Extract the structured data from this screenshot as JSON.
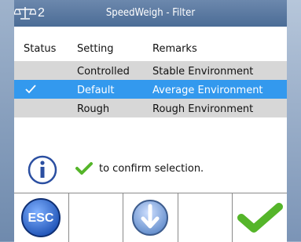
{
  "header": {
    "scale_number": "2",
    "title": "SpeedWeigh - Filter"
  },
  "table": {
    "headers": {
      "status": "Status",
      "setting": "Setting",
      "remarks": "Remarks"
    },
    "rows": [
      {
        "setting": "Controlled",
        "remarks": "Stable Environment",
        "selected": false
      },
      {
        "setting": "Default",
        "remarks": "Average Environment",
        "selected": true
      },
      {
        "setting": "Rough",
        "remarks": "Rough Environment",
        "selected": false
      }
    ]
  },
  "hint": {
    "text": "to confirm selection."
  },
  "softkeys": {
    "esc_label": "ESC",
    "keys": [
      "esc-icon",
      "",
      "arrow-down-icon",
      "",
      "check-icon"
    ]
  },
  "colors": {
    "titlebar": "#4b6c96",
    "selected_row": "#3399ee",
    "grey_row": "#d7d7d7",
    "check_green": "#55b52a",
    "info_blue": "#2b4fa1"
  }
}
